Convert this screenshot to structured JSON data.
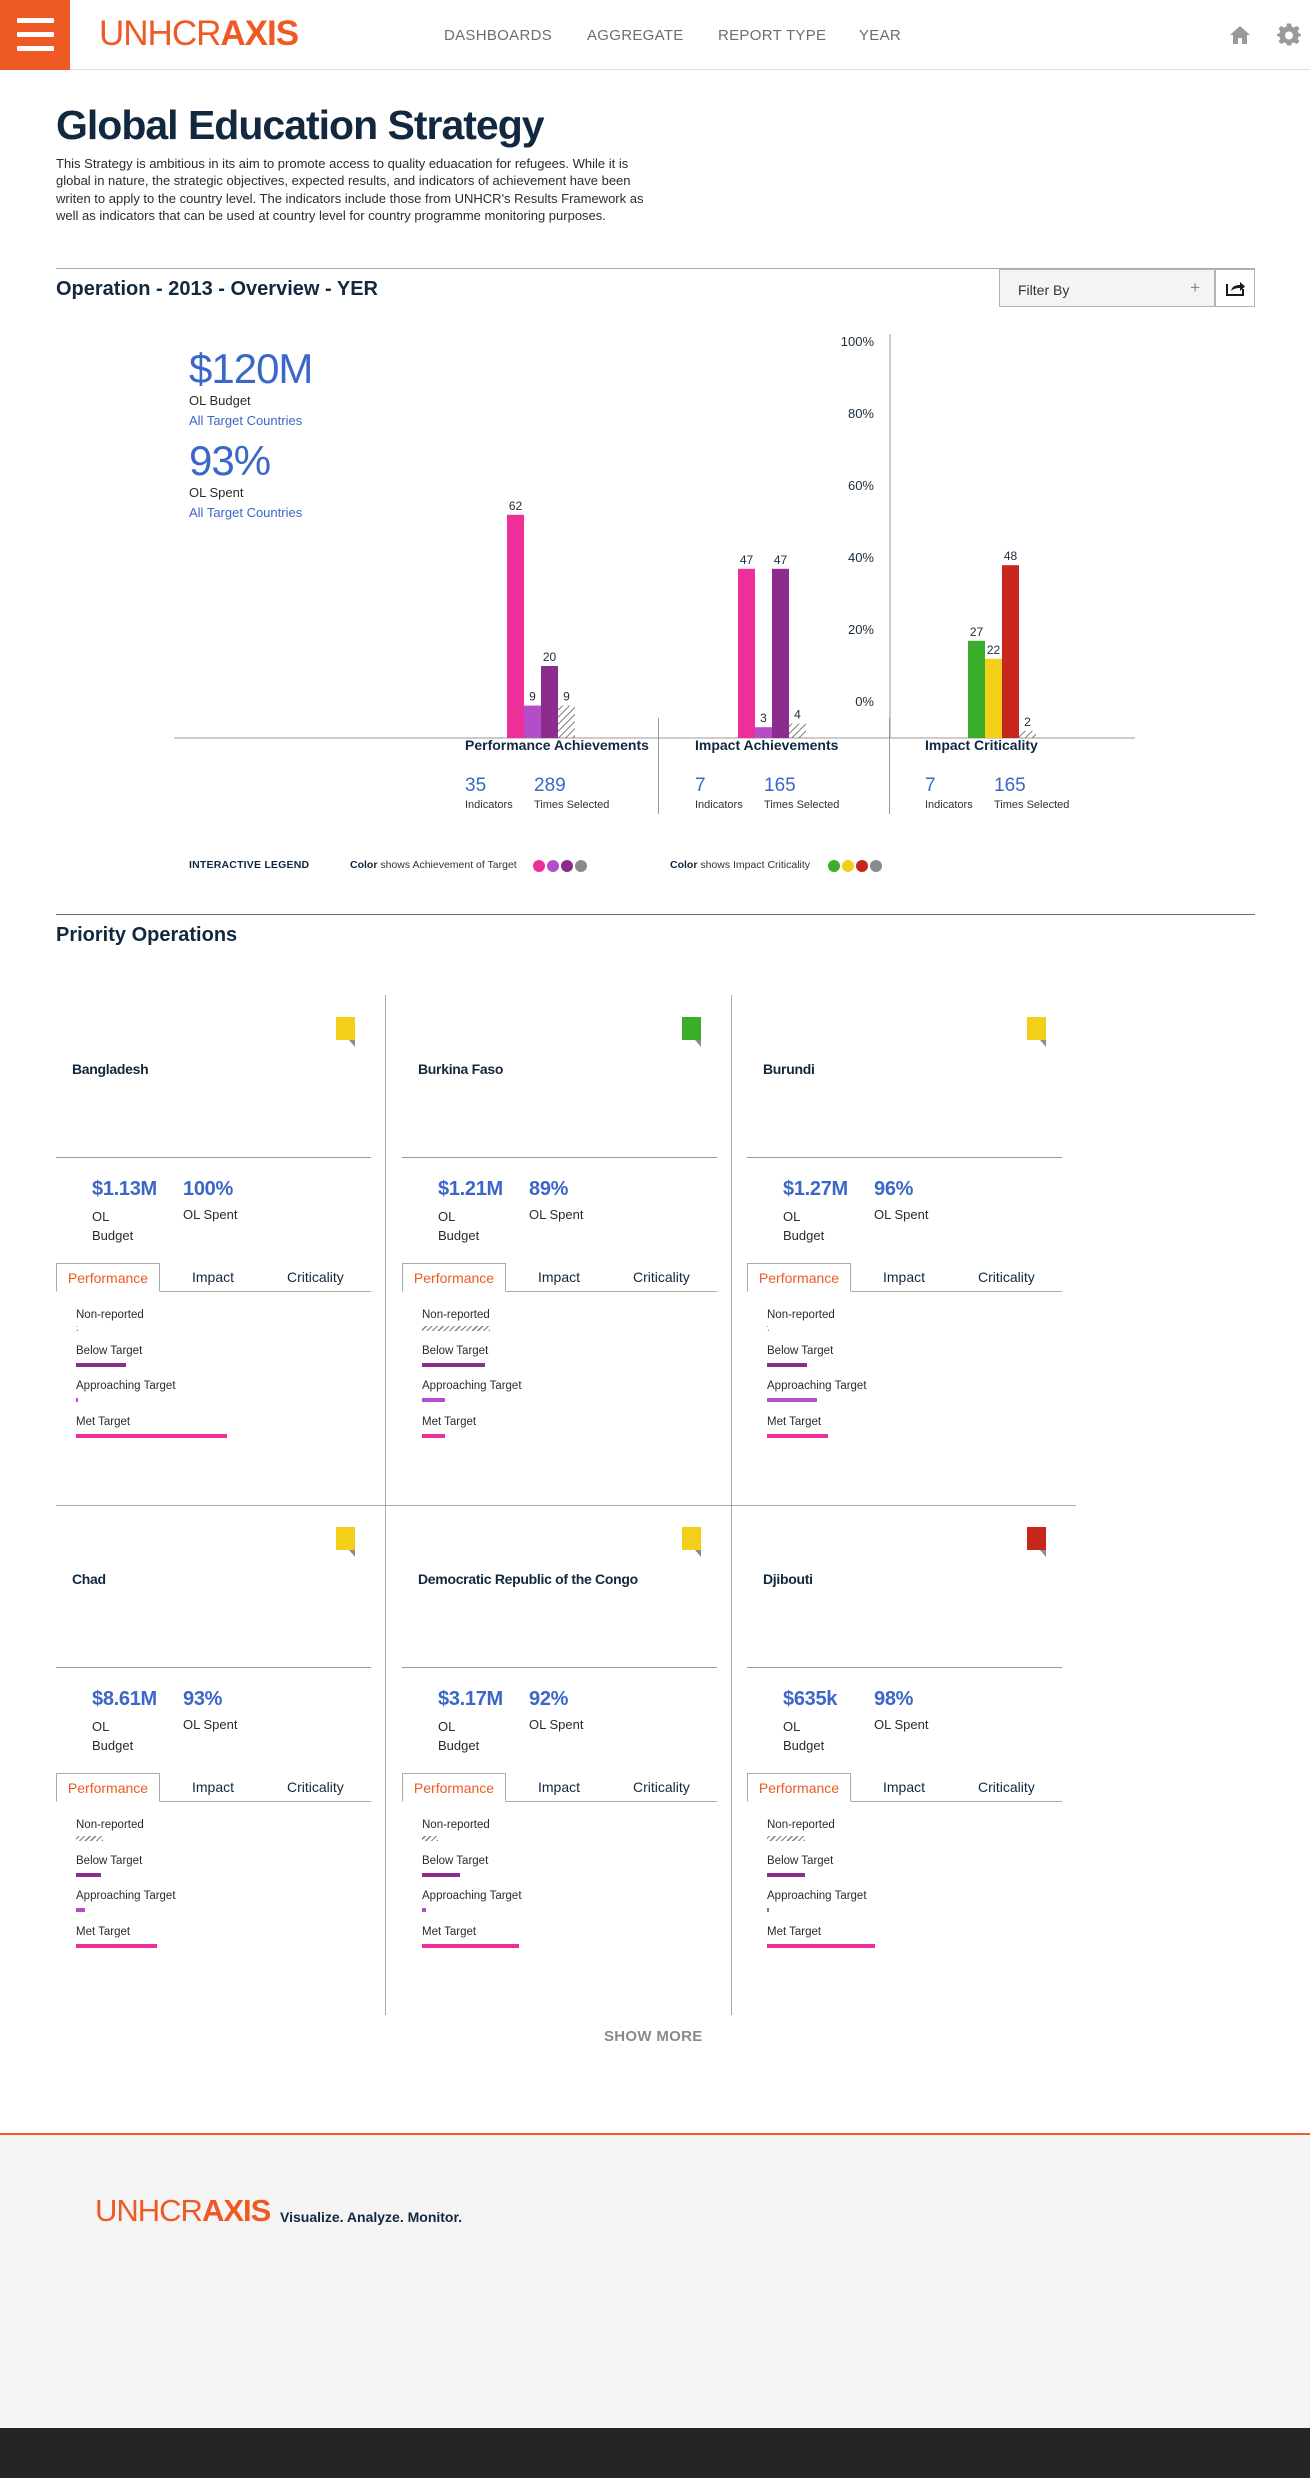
{
  "header": {
    "logo_thin": "UNHCR",
    "logo_bold": "AXIS",
    "nav": [
      "DASHBOARDS",
      "AGGREGATE",
      "REPORT TYPE",
      "YEAR"
    ],
    "icons": [
      "home-icon",
      "gear-icon"
    ]
  },
  "page": {
    "title": "Global Education Strategy",
    "intro": "This Strategy is ambitious in its aim to promote access to quality eduacation for refugees. While it is global in nature, the strategic objectives, expected results, and indicators of achievement have been writen to apply to the country level. The indicators include those from UNHCR's Results Framework as well as indicators that can be used at country level for country programme monitoring purposes."
  },
  "overview": {
    "title": "Operation - 2013 - Overview - YER",
    "filter_label": "Filter By",
    "filter_plus": "+",
    "budget_value": "$120M",
    "budget_label": "OL Budget",
    "budget_link": "All Target Countries",
    "spent_value": "93%",
    "spent_label": "OL Spent",
    "spent_link": "All Target Countries"
  },
  "chart_data": {
    "type": "bar",
    "y_ticks": [
      "100%",
      "80%",
      "60%",
      "40%",
      "20%",
      "0%"
    ],
    "ylim": [
      0,
      100
    ],
    "groups": [
      {
        "title": "Performance Achievements",
        "indicators": "35",
        "indicators_label": "Indicators",
        "times": "289",
        "times_label": "Times Selected",
        "bars": [
          {
            "value": 62,
            "color": "#ee2f9a"
          },
          {
            "value": 9,
            "color": "#b44dc9"
          },
          {
            "value": 20,
            "color": "#8c2c8e"
          },
          {
            "value": 9,
            "color": "hatch"
          }
        ]
      },
      {
        "title": "Impact Achievements",
        "indicators": "7",
        "indicators_label": "Indicators",
        "times": "165",
        "times_label": "Times Selected",
        "bars": [
          {
            "value": 47,
            "color": "#ee2f9a"
          },
          {
            "value": 3,
            "color": "#b44dc9"
          },
          {
            "value": 47,
            "color": "#8c2c8e"
          },
          {
            "value": 4,
            "color": "hatch"
          }
        ]
      },
      {
        "title": "Impact Criticality",
        "indicators": "7",
        "indicators_label": "Indicators",
        "times": "165",
        "times_label": "Times Selected",
        "bars": [
          {
            "value": 27,
            "color": "#3aad2a"
          },
          {
            "value": 22,
            "color": "#f2cf18"
          },
          {
            "value": 48,
            "color": "#c6261c"
          },
          {
            "value": 2,
            "color": "hatch"
          }
        ]
      }
    ]
  },
  "legend": {
    "title": "INTERACTIVE LEGEND",
    "achievement_bold": "Color",
    "achievement_rest": " shows Achievement of Target",
    "criticality_bold": "Color",
    "criticality_rest": " shows Impact Criticality",
    "achievement_colors": [
      "#ee2f9a",
      "#b44dc9",
      "#8c2c8e",
      "#8a8a8a"
    ],
    "criticality_colors": [
      "#3aad2a",
      "#f2cf18",
      "#c6261c",
      "#8a8a8a"
    ]
  },
  "priority": {
    "title": "Priority Operations",
    "show_more": "SHOW MORE",
    "metric_labels": [
      "Non-reported",
      "Below Target",
      "Approaching Target",
      "Met Target"
    ],
    "metric_colors": [
      "hatch",
      "#8c2c8e",
      "#b44dc9",
      "#ee2f9a"
    ],
    "tabs": [
      "Performance",
      "Impact",
      "Criticality"
    ],
    "countries": [
      {
        "name": "Bangladesh",
        "budget": "$1.13M",
        "budget_label": "OL Budget",
        "spent": "100%",
        "spent_label": "OL Spent",
        "flag": "#f2cf18",
        "metrics": [
          1,
          28,
          1,
          84
        ]
      },
      {
        "name": "Burkina Faso",
        "budget": "$1.21M",
        "budget_label": "OL Budget",
        "spent": "89%",
        "spent_label": "OL Spent",
        "flag": "#3aad2a",
        "metrics": [
          38,
          35,
          13,
          13
        ]
      },
      {
        "name": "Burundi",
        "budget": "$1.27M",
        "budget_label": "OL Budget",
        "spent": "96%",
        "spent_label": "OL Spent",
        "flag": "#f2cf18",
        "metrics": [
          1,
          22,
          28,
          34
        ]
      },
      {
        "name": "Chad",
        "budget": "$8.61M",
        "budget_label": "OL Budget",
        "spent": "93%",
        "spent_label": "OL Spent",
        "flag": "#f2cf18",
        "metrics": [
          15,
          14,
          5,
          45
        ]
      },
      {
        "name": "Democratic Republic of the Congo",
        "budget": "$3.17M",
        "budget_label": "OL Budget",
        "spent": "92%",
        "spent_label": "OL Spent",
        "flag": "#f2cf18",
        "metrics": [
          9,
          21,
          2,
          54
        ]
      },
      {
        "name": "Djibouti",
        "budget": "$635k",
        "budget_label": "OL Budget",
        "spent": "98%",
        "spent_label": "OL Spent",
        "flag": "#c6261c",
        "metrics": [
          21,
          21,
          1,
          60
        ]
      }
    ]
  },
  "footer": {
    "logo_thin": "UNHCR",
    "logo_bold": "AXIS",
    "tagline": "Visualize. Analyze. Monitor."
  }
}
